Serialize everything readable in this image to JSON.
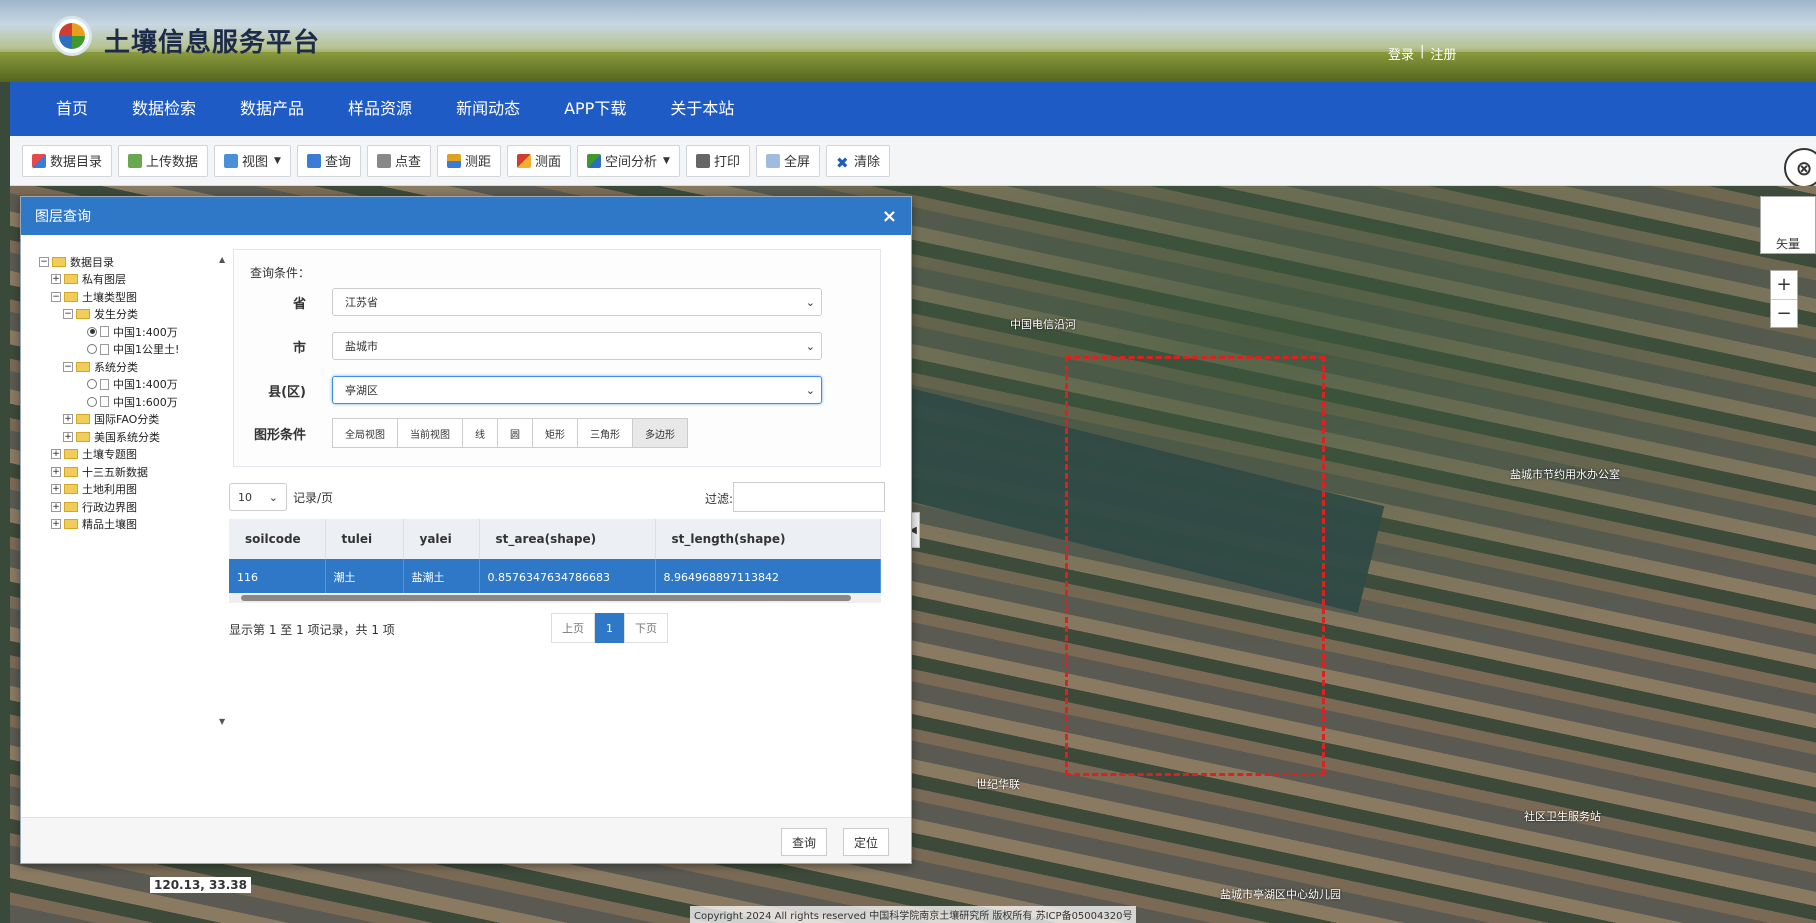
{
  "header": {
    "site_title": "土壤信息服务平台",
    "login": "登录",
    "register": "注册"
  },
  "nav": [
    "首页",
    "数据检索",
    "数据产品",
    "样品资源",
    "新闻动态",
    "APP下载",
    "关于本站"
  ],
  "toolbar": {
    "catalog": "数据目录",
    "upload": "上传数据",
    "view": "视图",
    "query": "查询",
    "point_query": "点查",
    "measure_dist": "测距",
    "measure_area": "测面",
    "spatial_analysis": "空间分析",
    "print": "打印",
    "fullscreen": "全屏",
    "clear": "清除"
  },
  "map": {
    "map_type_label": "矢量",
    "zoom_in": "+",
    "zoom_out": "−",
    "coords": "120.13, 33.38",
    "copyright": "Copyright 2024 All rights reserved 中国科学院南京土壤研究所 版权所有 苏ICP备05004320号",
    "labels": {
      "l1": "中国电信沿河",
      "l2": "盐城市节约用水办公室",
      "l3": "世纪华联",
      "l4": "盐城市亭湖区中心幼儿园",
      "l5": "社区卫生服务站"
    }
  },
  "dialog": {
    "title": "图层查询",
    "close": "×",
    "tree": {
      "root": "数据目录",
      "private": "私有图层",
      "soil_type": "土壤类型图",
      "genetic": "发生分类",
      "g1": "中国1:400万",
      "g2": "中国1公里土!",
      "system": "系统分类",
      "s1": "中国1:400万",
      "s2": "中国1:600万",
      "fao": "国际FAO分类",
      "usa": "美国系统分类",
      "topic": "土壤专题图",
      "fiveyear": "十三五新数据",
      "landuse": "土地利用图",
      "admin": "行政边界图",
      "fine": "精品土壤图"
    },
    "conditions": {
      "title": "查询条件：",
      "province_label": "省",
      "province_value": "江苏省",
      "city_label": "市",
      "city_value": "盐城市",
      "county_label": "县(区)",
      "county_value": "亭湖区",
      "shape_label": "图形条件",
      "shapes": [
        "全局视图",
        "当前视图",
        "线",
        "圆",
        "矩形",
        "三角形",
        "多边形"
      ]
    },
    "page_size": "10",
    "per_page": "记录/页",
    "filter_label": "过滤:",
    "table": {
      "headers": [
        "soilcode",
        "tulei",
        "yalei",
        "st_area(shape)",
        "st_length(shape)"
      ],
      "rows": [
        [
          "116",
          "潮土",
          "盐潮土",
          "0.8576347634786683",
          "8.964968897113842"
        ]
      ]
    },
    "summary": "显示第 1 至 1 项记录，共 1 项",
    "pager": {
      "prev": "上页",
      "current": "1",
      "next": "下页"
    },
    "footer": {
      "query": "查询",
      "locate": "定位"
    }
  }
}
